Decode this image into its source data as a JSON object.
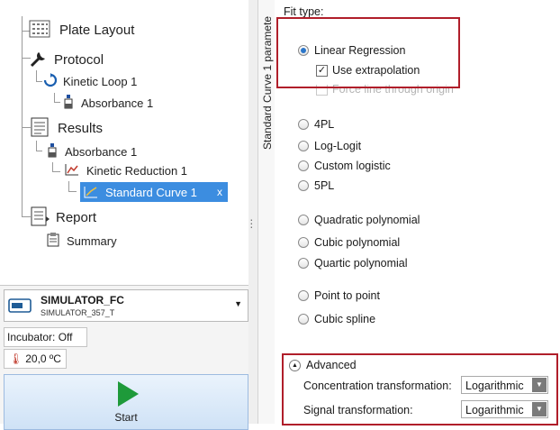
{
  "tree": {
    "plate_layout": "Plate Layout",
    "protocol": "Protocol",
    "kinetic_loop": "Kinetic Loop 1",
    "absorbance_protocol": "Absorbance 1",
    "results": "Results",
    "absorbance_results": "Absorbance 1",
    "kinetic_reduction": "Kinetic Reduction 1",
    "standard_curve": "Standard Curve 1",
    "standard_curve_close": "x",
    "report": "Report",
    "summary": "Summary"
  },
  "instrument": {
    "name": "SIMULATOR_FC",
    "id": "SIMULATOR_357_T",
    "incubator": "Incubator: Off",
    "temperature": "20,0 ºC",
    "start_label": "Start"
  },
  "panel": {
    "vertical_tab": "Standard Curve 1 paramete"
  },
  "fit": {
    "heading": "Fit type:",
    "selected": "Linear Regression",
    "options": {
      "linear": "Linear Regression",
      "fourpl": "4PL",
      "loglogit": "Log-Logit",
      "custom_logistic": "Custom logistic",
      "fivepl": "5PL",
      "quadratic": "Quadratic polynomial",
      "cubic": "Cubic polynomial",
      "quartic": "Quartic polynomial",
      "point_to_point": "Point to point",
      "cubic_spline": "Cubic spline"
    },
    "use_extrapolation": "Use extrapolation",
    "force_origin": "Force line through origin"
  },
  "advanced": {
    "label": "Advanced",
    "concentration_label": "Concentration transformation:",
    "concentration_value": "Logarithmic",
    "signal_label": "Signal transformation:",
    "signal_value": "Logarithmic"
  },
  "colors": {
    "selection": "#3c8de0",
    "highlight_border": "#b01e2a",
    "start_arrow": "#1e9a3a"
  }
}
